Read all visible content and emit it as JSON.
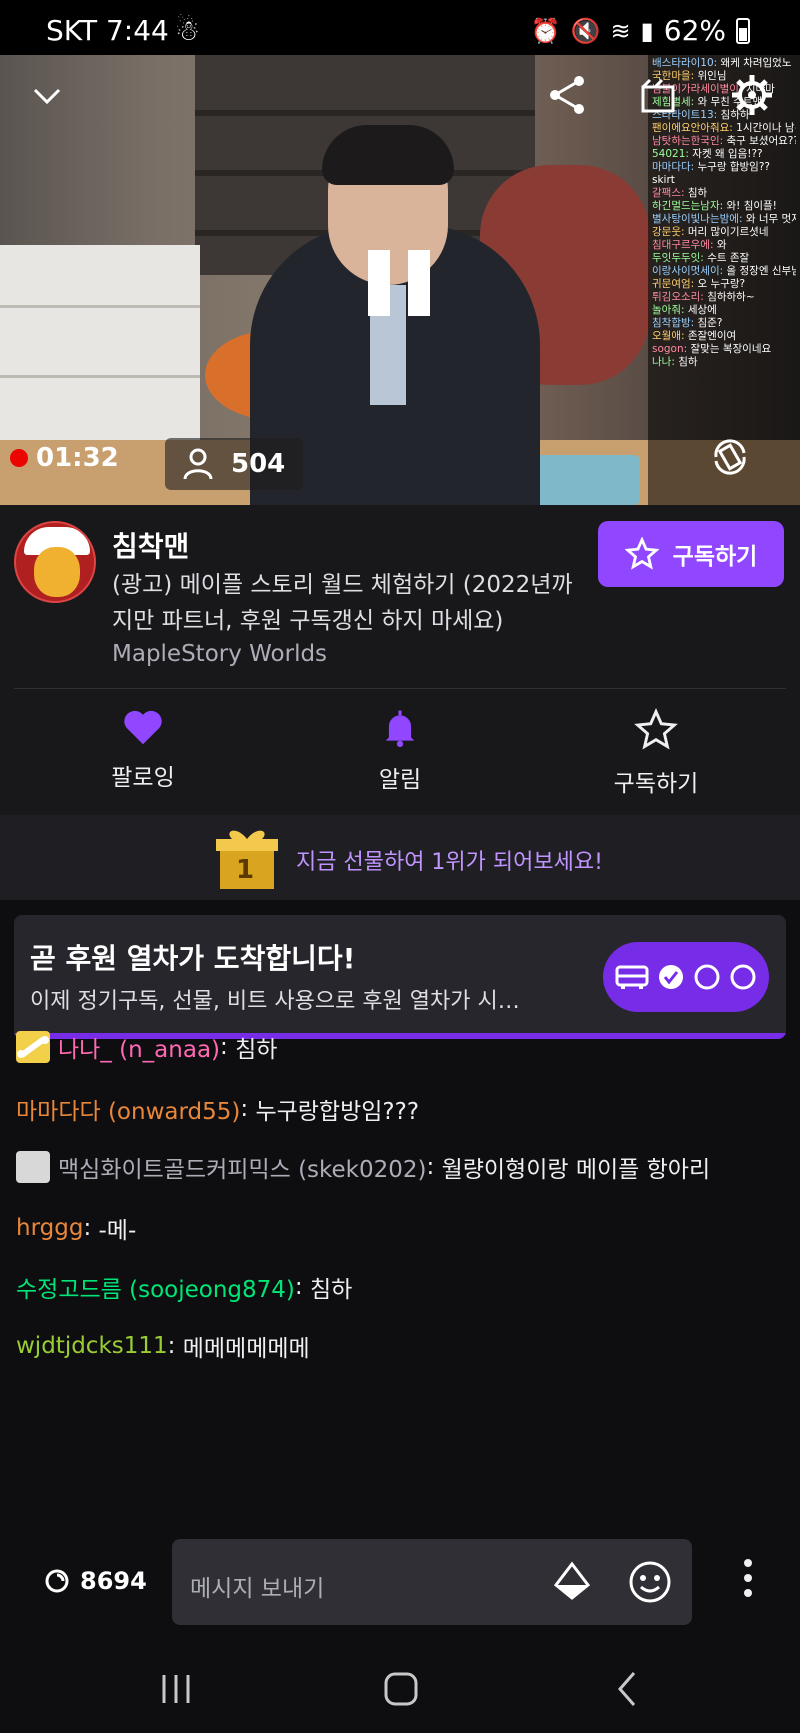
{
  "status_bar": {
    "carrier_time": "SKT 7:44",
    "battery": "62%"
  },
  "video": {
    "live_time": "01:32",
    "viewer_count": "504",
    "overlay_chat": [
      {
        "user": "배스타라이10",
        "text": "왜케 차려입었노"
      },
      {
        "user": "국한마을",
        "text": "위인님"
      },
      {
        "user": "님불이가라세이별이",
        "text": "치마마"
      },
      {
        "user": "제힘별세",
        "text": "와 무친 수트맨"
      },
      {
        "user": "스타라이트13",
        "text": "침하하"
      },
      {
        "user": "팬이에요안아줘요",
        "text": "1시간이나 남~았는데"
      },
      {
        "user": "남탓하는한국인",
        "text": "축구 보셨어요??"
      },
      {
        "user": "54021",
        "text": "자켓 왜 입음!??"
      },
      {
        "user": "마마다다",
        "text": "누구랑 합방임??"
      },
      {
        "user": "",
        "text": "skirt"
      },
      {
        "user": "갈팩스",
        "text": "침하"
      },
      {
        "user": "하긴멀드는남자",
        "text": "와! 침이플!"
      },
      {
        "user": "별사탕이빛나는밤에",
        "text": "와 너무 멋지당!"
      },
      {
        "user": "강문웃",
        "text": "머리 많이기르셧네"
      },
      {
        "user": "침대구르우에",
        "text": "와"
      },
      {
        "user": "두잇두두잇",
        "text": "수트 존잘"
      },
      {
        "user": "이랑사이멋세이",
        "text": "올 정장엔 신부님같네"
      },
      {
        "user": "귀문여엄",
        "text": "오 누구랑?"
      },
      {
        "user": "튀김오소리",
        "text": "침하하하~"
      },
      {
        "user": "놀아줘",
        "text": "세상에"
      },
      {
        "user": "침착합방",
        "text": "침준?"
      },
      {
        "user": "오월애",
        "text": "존잘엔이여"
      },
      {
        "user": "sogon",
        "text": "잘맞는 복장이네요"
      },
      {
        "user": "나나",
        "text": "침하"
      }
    ]
  },
  "channel": {
    "name": "침착맨",
    "title": "(광고) 메이플 스토리 월드 체험하기 (2022년까지만 파트너, 후원 구독갱신 하지 마세요)",
    "title_line1": "(광고) 메이플 스토리 월드 체험하기 (2022년까",
    "title_line2": "지만 파트너, 후원 구독갱신 하지 마세요)",
    "game": "MapleStory Worlds",
    "subscribe_label": "구독하기"
  },
  "actions": {
    "follow_label": "팔로잉",
    "notify_label": "알림",
    "subscribe_label": "구독하기"
  },
  "gift_banner": {
    "rank": "1",
    "text": "지금 선물하여 1위가 되어보세요!"
  },
  "hype_train": {
    "title": "곧 후원 열차가 도착합니다!",
    "description": "이제 정기구독, 선물, 비트 사용으로 후원 열차가 시작됩...",
    "progress_fraction": 1.0
  },
  "chat": [
    {
      "user": "나나_ (n_anaa)",
      "text": "침하",
      "color": "#ff69b4",
      "badge": "bone"
    },
    {
      "user": "마마다다 (onward55)",
      "text": "누구랑합방임???",
      "color": "#e8863a",
      "badge": ""
    },
    {
      "user": "맥심화이트골드커피믹스 (skek0202)",
      "text": "월량이형이랑 메이플 항아리",
      "color": "#adadb8",
      "badge": "any"
    },
    {
      "user": "hrggg",
      "text": "-메-",
      "color": "#e8863a",
      "badge": ""
    },
    {
      "user": "수정고드름 (soojeong874)",
      "text": "침하",
      "color": "#00e676",
      "badge": ""
    },
    {
      "user": "wjdtjdcks111",
      "text": "메메메메메메",
      "color": "#9acd32",
      "badge": ""
    }
  ],
  "input": {
    "points": "8694",
    "placeholder": "메시지 보내기"
  },
  "colors": {
    "accent": "#9147ff",
    "live": "#eb0400",
    "background": "#0e0e10"
  }
}
